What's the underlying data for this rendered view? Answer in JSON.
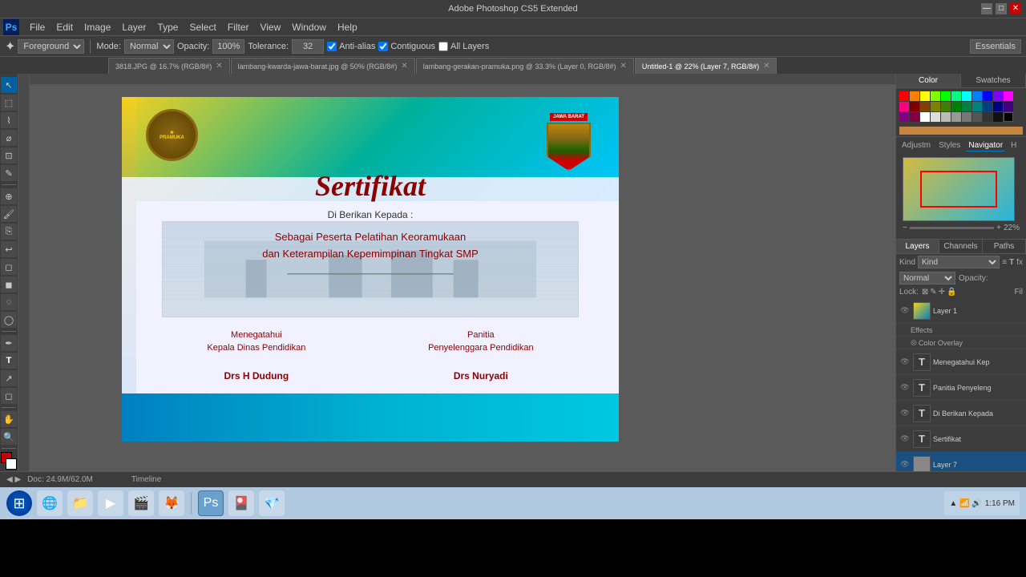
{
  "titlebar": {
    "title": "Adobe Photoshop CS5 Extended",
    "minimize": "—",
    "maximize": "□",
    "close": "✕"
  },
  "menubar": {
    "logo": "Ps",
    "items": [
      "File",
      "Edit",
      "Image",
      "Layer",
      "Type",
      "Select",
      "Filter",
      "View",
      "Window",
      "Help"
    ]
  },
  "toolbar": {
    "foreground_label": "Foreground",
    "mode_label": "Mode:",
    "mode_value": "Normal",
    "opacity_label": "Opacity:",
    "opacity_value": "100%",
    "tolerance_label": "Tolerance:",
    "tolerance_value": "32",
    "anti_alias_label": "Anti-alias",
    "contiguous_label": "Contiguous",
    "all_layers_label": "All Layers",
    "essentials_label": "Essentials"
  },
  "tabs": [
    {
      "label": "3818.JPG @ 16.7% (RGB/8#)",
      "active": false
    },
    {
      "label": "lambang-kwarda-jawa-barat.jpg @ 50% (RGB/8#)",
      "active": false
    },
    {
      "label": "lambang-gerakan-pramuka.png @ 33.3% (Layer 0, RGB/8#)",
      "active": false
    },
    {
      "label": "Untitled-1 @ 22% (Layer 7, RGB/8#)",
      "active": true
    }
  ],
  "certificate": {
    "title": "Sertifikat",
    "subtitle": "Di Berikan Kepada :",
    "main_text_1": "Sebagai Peserta Pelatihan Keoramukaan",
    "main_text_2": "dan Keterampilan Kepemimpinan Tingkat SMP",
    "signer1_title1": "Menegatahui",
    "signer1_title2": "Kepala Dinas Pendidikan",
    "signer1_name": "Drs H Dudung",
    "signer2_title1": "Panitia",
    "signer2_title2": "Penyelenggara Pendidikan",
    "signer2_name": "Drs Nuryadi",
    "jawa_barat": "JAWA BARAT"
  },
  "right_panel": {
    "top_tabs": [
      "Color",
      "Swatches"
    ],
    "nav_tabs": [
      "Adjustm",
      "Styles",
      "Navigator",
      "H"
    ],
    "zoom_value": "22%",
    "layers_tabs": [
      "Layers",
      "Channels",
      "Paths"
    ],
    "kind_label": "Kind",
    "blend_mode": "Normal",
    "opacity_label": "Opacity:",
    "lock_label": "Lock:",
    "fill_label": "Fil",
    "layers": [
      {
        "name": "Layer 1",
        "type": "image",
        "visible": true,
        "active": false,
        "has_effects": true,
        "effect": "Color Overlay"
      },
      {
        "name": "Menegatahui Kep",
        "type": "text",
        "visible": true,
        "active": false
      },
      {
        "name": "Panitia Penyeleng",
        "type": "text",
        "visible": true,
        "active": false
      },
      {
        "name": "Di Berikan Kepada",
        "type": "text",
        "visible": true,
        "active": false
      },
      {
        "name": "Sertifikat",
        "type": "text",
        "visible": true,
        "active": false
      },
      {
        "name": "Layer 7",
        "type": "image",
        "visible": true,
        "active": true
      }
    ]
  },
  "status_bar": {
    "doc_size": "Doc: 24.9M/62.0M",
    "timeline": "Timeline"
  },
  "taskbar": {
    "apps": [
      "🪟",
      "🌐",
      "📁",
      "▶",
      "🎬",
      "🦊",
      "Ps",
      "🎴",
      "💎"
    ],
    "time": "1:16 PM"
  }
}
